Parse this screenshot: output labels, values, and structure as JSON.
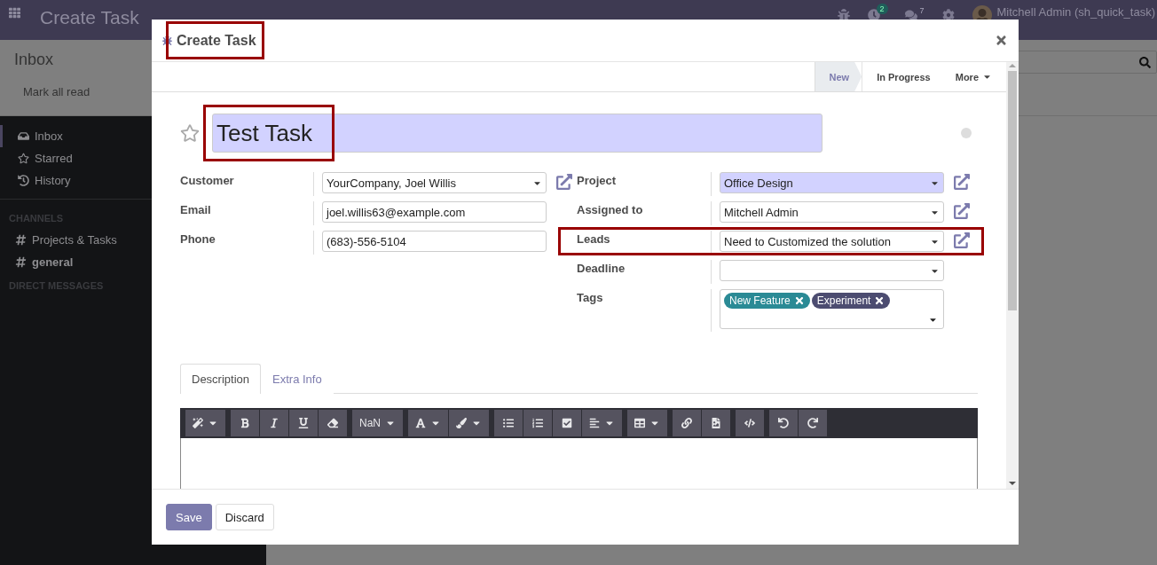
{
  "navbar": {
    "app_title": "Create Task",
    "activity_count": "2",
    "message_count": "7",
    "user": "Mitchell Admin (sh_quick_task)"
  },
  "control_panel": {
    "title": "Inbox",
    "mark_all_read": "Mark all read"
  },
  "sidebar": {
    "items": [
      {
        "label": "Inbox",
        "selected": true
      },
      {
        "label": "Starred",
        "selected": false
      },
      {
        "label": "History",
        "selected": false
      }
    ],
    "channels_heading": "CHANNELS",
    "channels": [
      {
        "label": "Projects & Tasks",
        "unread": false
      },
      {
        "label": "general",
        "unread": true
      }
    ],
    "direct_messages_heading": "DIRECT MESSAGES"
  },
  "modal": {
    "title": "Create Task",
    "title_highlighted": true,
    "stages": [
      {
        "label": "New",
        "selected": true
      },
      {
        "label": "In Progress",
        "selected": false
      }
    ],
    "more": "More",
    "task_name": "Test Task",
    "task_name_highlighted": true,
    "starred": false,
    "left_fields": [
      {
        "label": "Customer",
        "value": "YourCompany, Joel Willis",
        "kind": "select",
        "link": true,
        "required": false,
        "highlighted": false
      },
      {
        "label": "Email",
        "value": "joel.willis63@example.com",
        "kind": "text",
        "link": false,
        "required": false,
        "highlighted": false
      },
      {
        "label": "Phone",
        "value": "(683)-556-5104",
        "kind": "text",
        "link": false,
        "required": false,
        "highlighted": false
      }
    ],
    "right_fields": [
      {
        "label": "Project",
        "value": "Office Design",
        "kind": "select",
        "link": true,
        "required": true,
        "highlighted": false
      },
      {
        "label": "Assigned to",
        "value": "Mitchell Admin",
        "kind": "select",
        "link": true,
        "required": false,
        "highlighted": false
      },
      {
        "label": "Leads",
        "value": "Need to Customized the solution",
        "kind": "select",
        "link": true,
        "required": false,
        "highlighted": true
      },
      {
        "label": "Deadline",
        "kind": "select",
        "link": false,
        "required": false,
        "highlighted": false
      },
      {
        "label": "Tags",
        "kind": "tags",
        "link": false,
        "required": false,
        "highlighted": false,
        "tags": [
          {
            "label": "New Feature",
            "color": "#2a8a95"
          },
          {
            "label": "Experiment",
            "color": "#4c4c70"
          }
        ]
      }
    ],
    "tabs": [
      {
        "label": "Description",
        "selected": true
      },
      {
        "label": "Extra Info",
        "selected": false
      }
    ],
    "font_size": "NaN",
    "buttons": [
      {
        "label": "Save",
        "kind": "primary"
      },
      {
        "label": "Discard",
        "kind": "secondary"
      }
    ]
  }
}
